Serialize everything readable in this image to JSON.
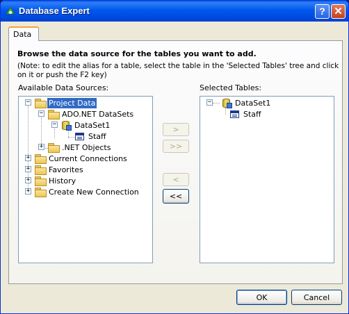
{
  "window": {
    "title": "Database Expert",
    "help_label": "?",
    "close_label": "✕"
  },
  "tabs": [
    {
      "label": "Data",
      "active": true
    }
  ],
  "instructions": {
    "heading": "Browse the data source for the tables you want to add.",
    "note": "(Note: to edit the alias for a table, select the table in the 'Selected Tables' tree and click on it or push the F2 key)"
  },
  "available": {
    "label": "Available Data Sources:",
    "nodes": [
      {
        "label": "Project Data",
        "expander": "−",
        "selected": true
      },
      {
        "label": "ADO.NET DataSets",
        "expander": "−"
      },
      {
        "label": "DataSet1",
        "expander": "−"
      },
      {
        "label": "Staff",
        "expander": ""
      },
      {
        "label": ".NET Objects",
        "expander": "+"
      },
      {
        "label": "Current Connections",
        "expander": "+"
      },
      {
        "label": "Favorites",
        "expander": "+"
      },
      {
        "label": "History",
        "expander": "+"
      },
      {
        "label": "Create New Connection",
        "expander": "+"
      }
    ]
  },
  "move_buttons": {
    "add": {
      "label": ">",
      "enabled": false
    },
    "add_all": {
      "label": ">>",
      "enabled": false
    },
    "remove": {
      "label": "<",
      "enabled": false
    },
    "remove_all": {
      "label": "<<",
      "enabled": true
    }
  },
  "selected": {
    "label": "Selected Tables:",
    "nodes": [
      {
        "label": "DataSet1",
        "expander": "−"
      },
      {
        "label": "Staff",
        "expander": ""
      }
    ]
  },
  "footer": {
    "ok_label": "OK",
    "cancel_label": "Cancel"
  },
  "colors": {
    "titlebar": "#0058ee",
    "selection": "#316ac5",
    "tab_accent": "#f5a531"
  }
}
